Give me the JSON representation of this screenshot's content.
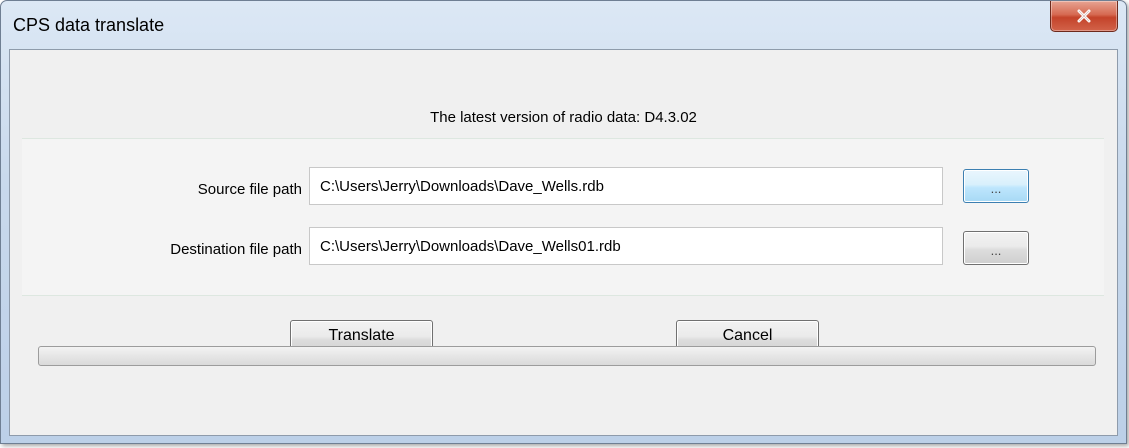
{
  "window": {
    "title": "CPS data translate"
  },
  "header": {
    "version_text": "The latest version of radio data: D4.3.02"
  },
  "source": {
    "label": "Source file path",
    "value": "C:\\Users\\Jerry\\Downloads\\Dave_Wells.rdb",
    "browse_label": "..."
  },
  "destination": {
    "label": "Destination file path",
    "value": "C:\\Users\\Jerry\\Downloads\\Dave_Wells01.rdb",
    "browse_label": "..."
  },
  "actions": {
    "translate_label": "Translate",
    "cancel_label": "Cancel"
  },
  "progress": {
    "fraction": 0
  },
  "icons": {
    "close": "close-icon"
  },
  "colors": {
    "close_button": "#c4432a",
    "focus_button": "#3c7fb1"
  }
}
